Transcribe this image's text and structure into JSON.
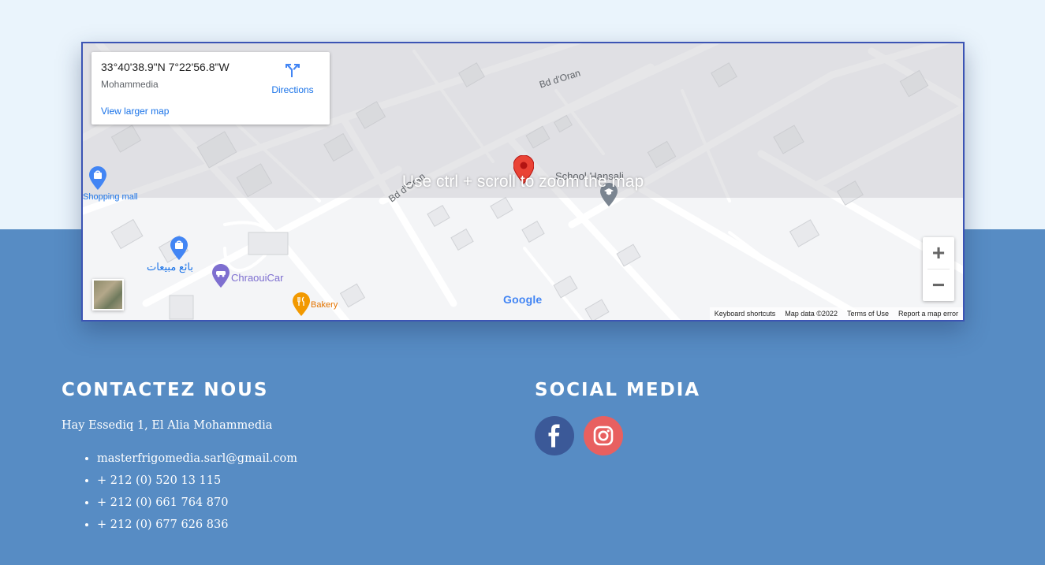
{
  "map": {
    "coordinates": "33°40'38.9\"N 7°22'56.8\"W",
    "place": "Mohammedia",
    "view_larger": "View larger map",
    "directions": "Directions",
    "zoom_hint": "Use ctrl + scroll to zoom the map",
    "street_labels": [
      "Bd d'Oran",
      "Bd d'Oran"
    ],
    "pois": {
      "school": "School Hansali",
      "shopping": "Shopping mall",
      "arabic_shop": "بائع مبيعات",
      "car": "ChraouiCar",
      "bakery": "Bakery"
    },
    "logo": "Google",
    "attribution": [
      "Keyboard shortcuts",
      "Map data ©2022",
      "Terms of Use",
      "Report a map error"
    ],
    "zoom_in": "+",
    "zoom_out": "−"
  },
  "contact": {
    "heading": "CONTACTEZ NOUS",
    "address": "Hay Essediq 1, El Alia Mohammedia",
    "items": [
      "masterfrigomedia.sarl@gmail.com",
      "+ 212 (0) 520 13 115",
      "+ 212 (0) 661 764 870",
      "+ 212 (0) 677 626 836"
    ]
  },
  "social": {
    "heading": "SOCIAL MEDIA",
    "icons": [
      "facebook-icon",
      "instagram-icon"
    ]
  },
  "colors": {
    "footer_bg": "#578cc4",
    "top_bg": "#eaf4fc",
    "map_border": "#3c54b4",
    "facebook": "#3b5998",
    "instagram": "#e86060"
  }
}
